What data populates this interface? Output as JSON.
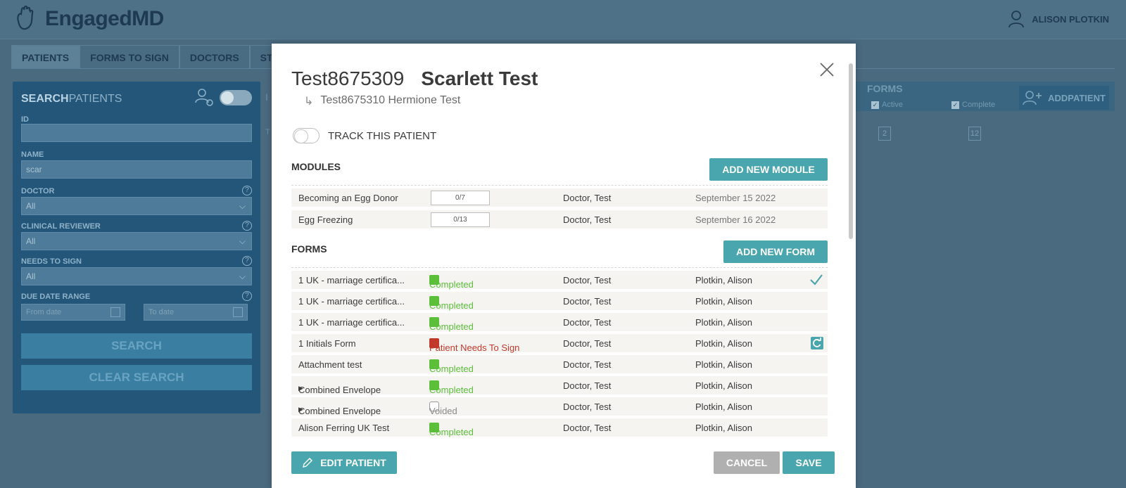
{
  "app": {
    "logo_text": "EngagedMD",
    "user_name": "ALISON PLOTKIN"
  },
  "nav": {
    "tabs": [
      {
        "label": "PATIENTS"
      },
      {
        "label": "FORMS TO SIGN"
      },
      {
        "label": "DOCTORS"
      },
      {
        "label": "ST"
      }
    ]
  },
  "search_panel": {
    "title_bold": "SEARCH",
    "title_rest": "PATIENTS",
    "id_label": "ID",
    "id_value": "",
    "name_label": "NAME",
    "name_value": "scar",
    "doctor_label": "DOCTOR",
    "doctor_value": "All",
    "reviewer_label": "CLINICAL REVIEWER",
    "reviewer_value": "All",
    "needs_sign_label": "NEEDS TO SIGN",
    "needs_sign_value": "All",
    "due_range_label": "DUE DATE RANGE",
    "from_placeholder": "From date",
    "to_placeholder": "To date",
    "search_button": "SEARCH",
    "clear_button": "CLEAR SEARCH"
  },
  "background_table": {
    "id_header": "I",
    "row_prefix": "T",
    "forms_label": "FORMS",
    "active_label": "Active",
    "complete_label": "Complete",
    "add_bold": "ADD",
    "add_rest": "PATIENT",
    "active_count": "2",
    "complete_count": "12"
  },
  "modal": {
    "patient_id": "Test8675309",
    "patient_name": "Scarlett Test",
    "linked_arrow": "↳",
    "linked_patient": "Test8675310 Hermione Test",
    "track_label": "TRACK THIS PATIENT",
    "modules_heading": "MODULES",
    "add_module_button": "ADD NEW MODULE",
    "modules": [
      {
        "name": "Becoming an Egg Donor",
        "progress": "0/7",
        "doctor": "Doctor, Test",
        "date": "September 15 2022"
      },
      {
        "name": "Egg Freezing",
        "progress": "0/13",
        "doctor": "Doctor, Test",
        "date": "September 16 2022"
      }
    ],
    "forms_heading": "FORMS",
    "add_form_button": "ADD NEW FORM",
    "forms": [
      {
        "name": "1 UK - marriage certifica...",
        "status": "Completed",
        "doctor": "Doctor, Test",
        "reviewer": "Plotkin, Alison"
      },
      {
        "name": "1 UK - marriage certifica...",
        "status": "Completed",
        "doctor": "Doctor, Test",
        "reviewer": "Plotkin, Alison"
      },
      {
        "name": "1 UK - marriage certifica...",
        "status": "Completed",
        "doctor": "Doctor, Test",
        "reviewer": "Plotkin, Alison"
      },
      {
        "name": "1 Initials Form",
        "status": "Patient Needs To Sign",
        "doctor": "Doctor, Test",
        "reviewer": "Plotkin, Alison"
      },
      {
        "name": "Attachment test",
        "status": "Completed",
        "doctor": "Doctor, Test",
        "reviewer": "Plotkin, Alison"
      },
      {
        "name": "Combined Envelope",
        "status": "Completed",
        "doctor": "Doctor, Test",
        "reviewer": "Plotkin, Alison"
      },
      {
        "name": "Combined Envelope",
        "status": "Voided",
        "doctor": "Doctor, Test",
        "reviewer": "Plotkin, Alison"
      },
      {
        "name": "Alison Ferring UK Test",
        "status": "Completed",
        "doctor": "Doctor, Test",
        "reviewer": "Plotkin, Alison"
      }
    ],
    "edit_button": "EDIT PATIENT",
    "cancel_button": "CANCEL",
    "save_button": "SAVE"
  },
  "colors": {
    "teal": "#4aa6ae",
    "completed_green": "#5bbf3a",
    "needs_sign_red": "#c0392b",
    "cancel_grey": "#b0b0b0"
  }
}
